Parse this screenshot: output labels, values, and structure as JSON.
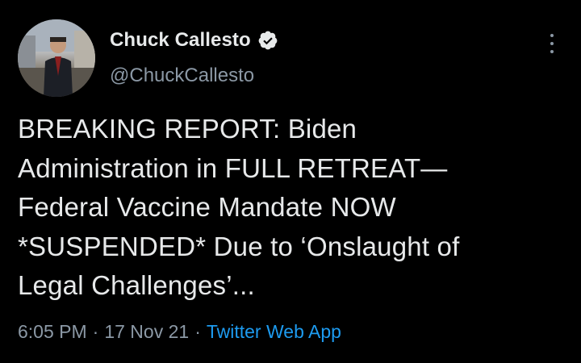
{
  "author": {
    "display_name": "Chuck Callesto",
    "handle": "@ChuckCallesto",
    "verified": true
  },
  "tweet": {
    "lines": [
      "BREAKING REPORT: Biden",
      "Administration in FULL RETREAT—",
      "Federal Vaccine Mandate NOW",
      "*SUSPENDED* Due to ‘Onslaught of",
      "Legal Challenges’..."
    ]
  },
  "meta": {
    "time": "6:05 PM",
    "date": "17 Nov 21",
    "source": "Twitter Web App",
    "separator": "·"
  },
  "icons": {
    "verified": "verified-badge-icon",
    "more": "more-options-icon"
  },
  "colors": {
    "background": "#000000",
    "text_primary": "#e7e9ea",
    "text_secondary": "#8b98a5",
    "link": "#1d9bf0"
  }
}
